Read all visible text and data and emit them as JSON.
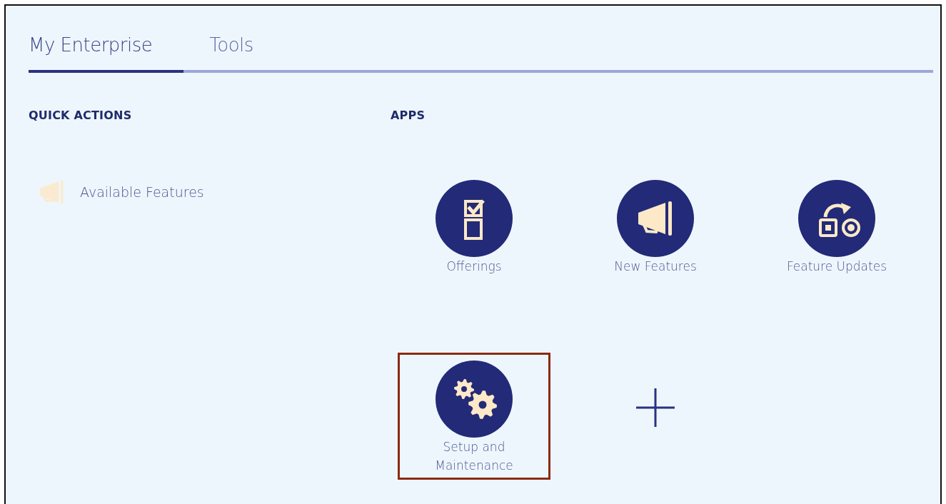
{
  "tabs": [
    {
      "label": "My Enterprise",
      "selected": true
    },
    {
      "label": "Tools",
      "selected": false
    }
  ],
  "quick_actions": {
    "heading": "QUICK ACTIONS",
    "items": [
      {
        "label": "Available Features",
        "kind": "megaphone"
      }
    ]
  },
  "apps": {
    "heading": "APPS",
    "items": [
      {
        "kind": "checklist",
        "label": "Offerings",
        "highlighted": false
      },
      {
        "kind": "megaphone",
        "label": "New Features",
        "highlighted": false
      },
      {
        "kind": "swap",
        "label": "Feature Updates",
        "highlighted": false
      },
      {
        "kind": "gears",
        "label": "Setup and Maintenance",
        "highlighted": true
      },
      {
        "kind": "add"
      }
    ]
  }
}
